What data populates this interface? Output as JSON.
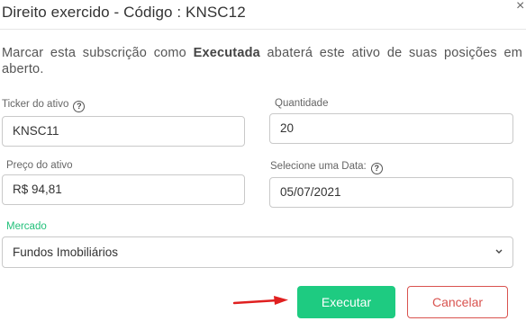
{
  "dialog": {
    "title": "Direito exercido - Código : KNSC12",
    "close_label": "×"
  },
  "description": {
    "prefix": "Marcar esta subscrição como ",
    "bold": "Executada",
    "suffix": " abaterá este ativo de suas posições em aberto."
  },
  "form": {
    "ticker": {
      "label": "Ticker do ativo",
      "value": "KNSC11"
    },
    "quantidade": {
      "label": "Quantidade",
      "value": "20"
    },
    "preco": {
      "label": "Preço do ativo",
      "value": "R$ 94,81"
    },
    "data": {
      "label": "Selecione uma Data:",
      "value": "05/07/2021"
    },
    "mercado": {
      "label": "Mercado",
      "value": "Fundos Imobiliários"
    },
    "help_icon": "?"
  },
  "buttons": {
    "executar": "Executar",
    "cancelar": "Cancelar"
  },
  "colors": {
    "primary": "#1ecb81",
    "danger": "#d9534f",
    "accent_label": "#22c07a",
    "annotation_arrow": "#e02020"
  }
}
